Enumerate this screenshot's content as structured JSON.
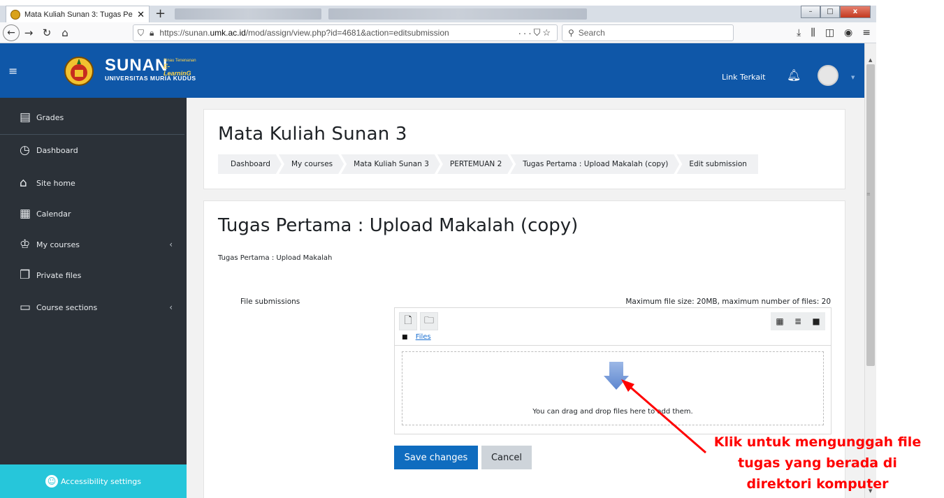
{
  "browser": {
    "tab_title": "Mata Kuliah Sunan 3: Tugas Pe",
    "tab_close": "✕",
    "new_tab": "+",
    "url_prefix": "https://sunan.",
    "url_domain": "umk.ac.id",
    "url_path": "/mod/assign/view.php?id=4681&action=editsubmission",
    "url_more": "···",
    "search_placeholder": "Search",
    "win_min": "–",
    "win_max": "□",
    "win_close": "x"
  },
  "header": {
    "brand_name": "SUNAN",
    "brand_tag_small": "Sinau Tenenanan",
    "brand_tag": "E-LearninG",
    "brand_sub": "UNIVERSITAS MURIA KUDUS",
    "link_terkait": "Link Terkait"
  },
  "sidebar": {
    "items": [
      {
        "label": "Grades"
      },
      {
        "label": "Dashboard"
      },
      {
        "label": "Site home"
      },
      {
        "label": "Calendar"
      },
      {
        "label": "My courses",
        "chevron": "‹"
      },
      {
        "label": "Private files"
      },
      {
        "label": "Course sections",
        "chevron": "‹"
      }
    ],
    "accessibility": "Accessibility settings"
  },
  "page": {
    "course_title": "Mata Kuliah Sunan 3",
    "breadcrumb": [
      "Dashboard",
      "My courses",
      "Mata Kuliah Sunan 3",
      "PERTEMUAN 2",
      "Tugas Pertama : Upload Makalah (copy)",
      "Edit submission"
    ],
    "assignment_title": "Tugas Pertama : Upload Makalah (copy)",
    "intro": "Tugas Pertama : Upload Makalah",
    "file_submissions_label": "File submissions",
    "limits": "Maximum file size: 20MB, maximum number of files: 20",
    "files_link": "Files",
    "drop_hint": "You can drag and drop files here to add them.",
    "save_label": "Save changes",
    "cancel_label": "Cancel"
  },
  "annotation": {
    "line1": "Klik untuk mengunggah file",
    "line2": "tugas yang berada di",
    "line3": "direktori komputer",
    "color": "#ff0000"
  },
  "colors": {
    "header_bg": "#0f57a8",
    "sidebar_bg": "#2b3138",
    "accent": "#0f6cbf",
    "accessibility_bg": "#26c6da"
  }
}
